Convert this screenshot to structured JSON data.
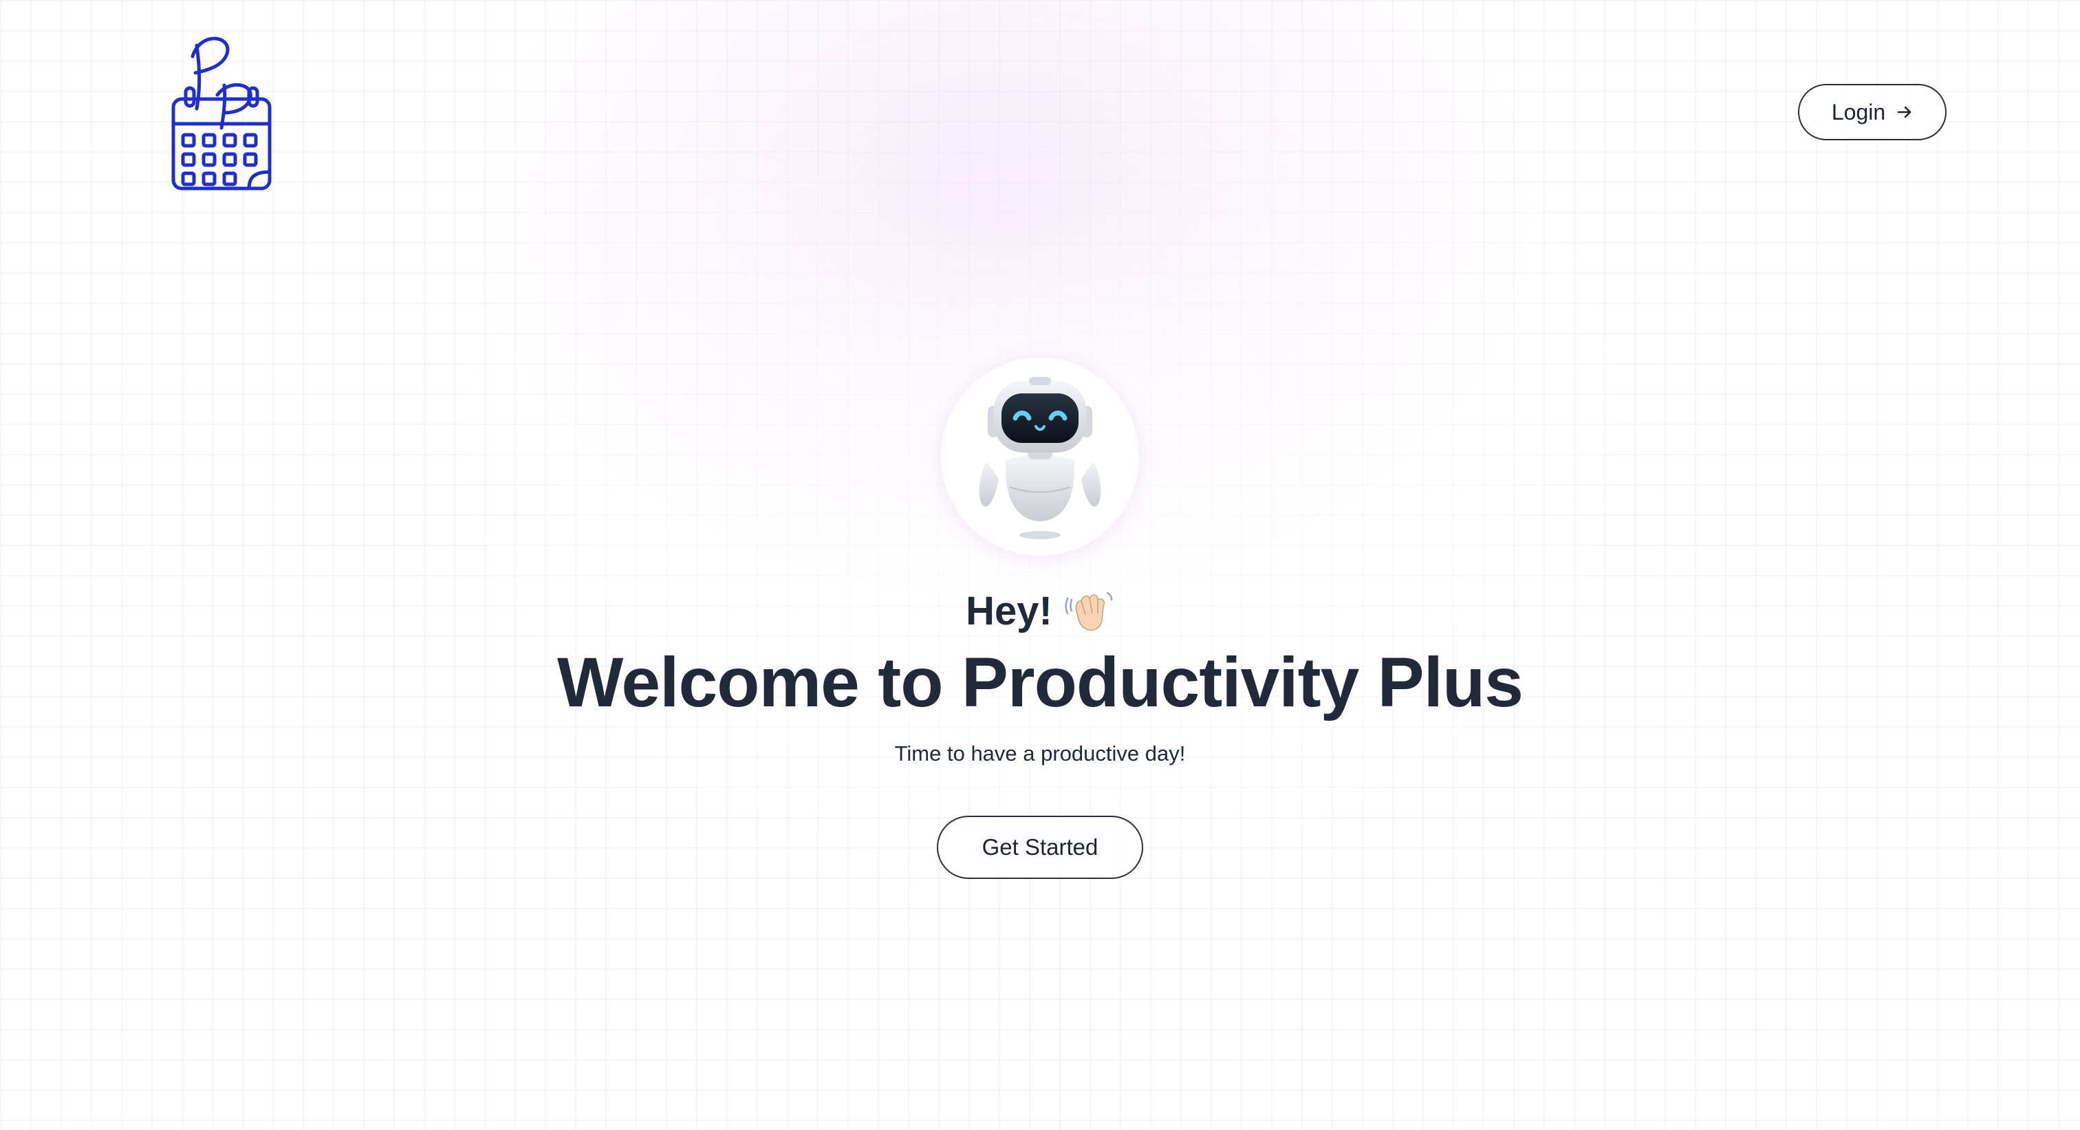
{
  "header": {
    "logo_icon": "calendar-logo-icon",
    "login_label": "Login",
    "login_icon": "arrow-right-icon"
  },
  "hero": {
    "avatar_icon": "robot-icon",
    "greeting": "Hey!",
    "greeting_icon": "waving-hand-icon",
    "title": "Welcome to Productivity Plus",
    "subtitle": "Time to have a productive day!",
    "cta_label": "Get Started"
  },
  "colors": {
    "brand": "#1d2fd0",
    "text": "#222938",
    "glow": "#e9b3f3",
    "robot_eyes": "#5fd3f0"
  }
}
